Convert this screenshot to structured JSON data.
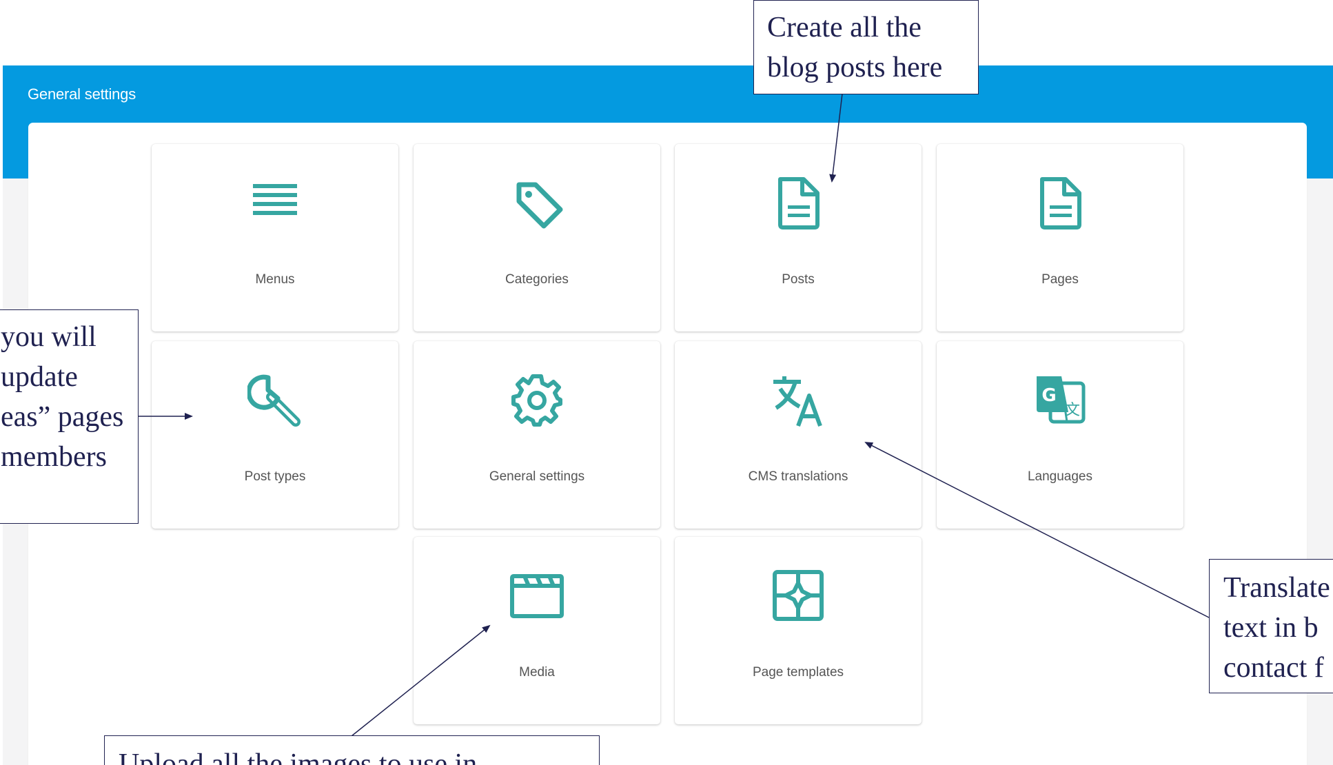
{
  "header": {
    "title": "General settings"
  },
  "accent_color": "#049ae0",
  "icon_color": "#36a6a1",
  "tiles": [
    {
      "label": "Menus",
      "icon": "menu-lines-icon"
    },
    {
      "label": "Categories",
      "icon": "tag-icon"
    },
    {
      "label": "Posts",
      "icon": "document-icon"
    },
    {
      "label": "Pages",
      "icon": "document-icon"
    },
    {
      "label": "Post types",
      "icon": "wrench-icon"
    },
    {
      "label": "General settings",
      "icon": "gear-icon"
    },
    {
      "label": "CMS translations",
      "icon": "translate-icon"
    },
    {
      "label": "Languages",
      "icon": "google-translate-icon"
    },
    {
      "label": "Media",
      "icon": "clapperboard-icon"
    },
    {
      "label": "Page templates",
      "icon": "template-icon"
    }
  ],
  "annotations": {
    "posts": {
      "line1": "Create all the",
      "line2": "blog posts here"
    },
    "post_types": {
      "line1": "you will",
      "line2": "update",
      "line3": "eas” pages",
      "line4": "members"
    },
    "translations": {
      "line1": "Translate",
      "line2": "text in b",
      "line3": "contact f"
    },
    "media": {
      "line1": "Upload all the images to use in"
    }
  }
}
